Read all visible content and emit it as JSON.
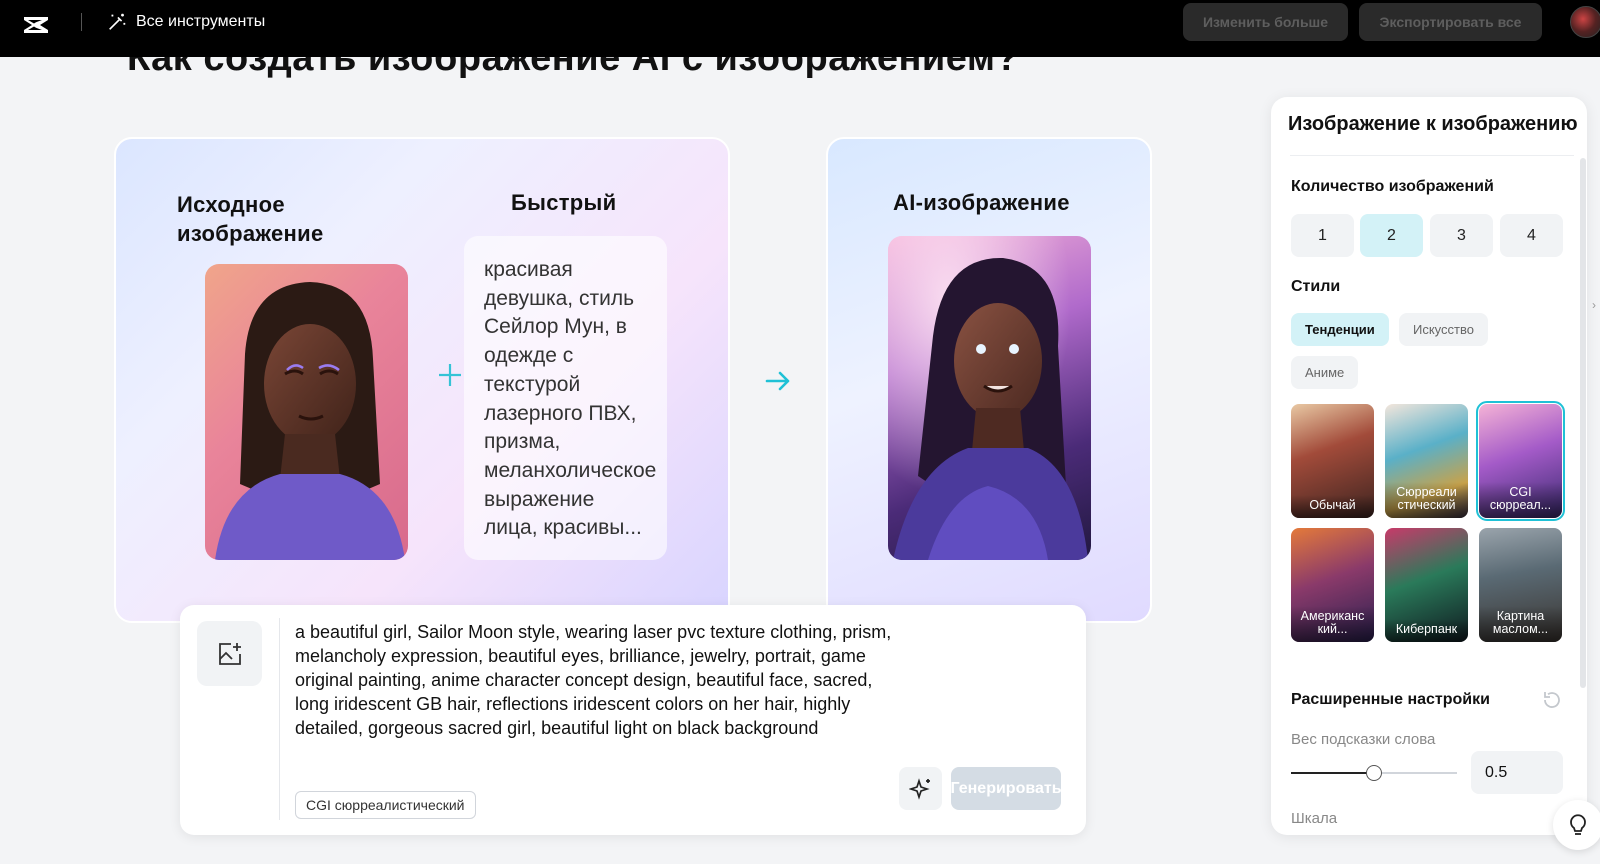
{
  "topbar": {
    "logo_icon": "capcut-logo",
    "tools_label": "Все инструменты",
    "edit_more_label": "Изменить больше",
    "export_all_label": "Экспортировать все"
  },
  "headline": "Как создать изображение AI с изображением?",
  "example": {
    "source_title": "Исходное изображение",
    "prompt_title": "Быстрый",
    "prompt_text": "красивая девушка, стиль Сейлор Мун, в одежде с текстурой лазерного ПВХ, призма, меланхолическое выражение лица, красивы...",
    "result_title": "AI-изображение"
  },
  "prompt_box": {
    "text": "a beautiful girl, Sailor Moon style, wearing laser pvc texture clothing, prism, melancholy expression, beautiful eyes, brilliance, jewelry, portrait, game original painting, anime character concept design, beautiful face, sacred, long iridescent GB hair, reflections iridescent colors on her hair, highly detailed, gorgeous sacred girl, beautiful light on black background",
    "style_tag": "CGI сюрреалистический",
    "generate_label": "Генерировать"
  },
  "panel": {
    "title": "Изображение к изображению",
    "count_label": "Количество изображений",
    "counts": [
      "1",
      "2",
      "3",
      "4"
    ],
    "count_selected": "2",
    "styles_label": "Стили",
    "style_tabs": [
      "Тенденции",
      "Искусство",
      "Аниме"
    ],
    "style_tab_selected": "Тенденции",
    "style_items": [
      {
        "label": "Обычай"
      },
      {
        "label": "Сюрреали стический"
      },
      {
        "label": "CGI сюрреал...",
        "selected": true
      },
      {
        "label": "Американс кий..."
      },
      {
        "label": "Киберпанк"
      },
      {
        "label": "Картина маслом..."
      }
    ],
    "advanced_label": "Расширенные настройки",
    "weight_label": "Вес подсказки слова",
    "weight_value": "0.5",
    "weight_fraction": 0.5,
    "scale_label": "Шкала"
  },
  "colors": {
    "accent": "#1fc1d6",
    "topbar": "#000000"
  }
}
